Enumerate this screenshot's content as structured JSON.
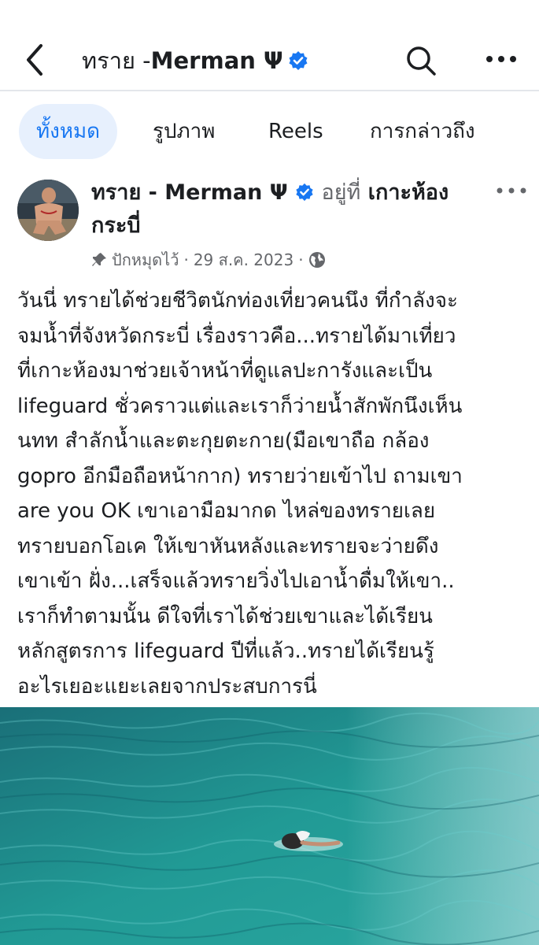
{
  "header": {
    "title_prefix": "ทราย - ",
    "title_name": "Merman Ψ",
    "icons": [
      "back-arrow-icon",
      "verified-badge-icon",
      "search-icon",
      "more-dots-icon"
    ]
  },
  "tabs": [
    {
      "label": "ทั้งหมด",
      "active": true
    },
    {
      "label": "รูปภาพ",
      "active": false
    },
    {
      "label": "Reels",
      "active": false
    },
    {
      "label": "การกล่าวถึง",
      "active": false
    }
  ],
  "post": {
    "author": "ทราย - Merman Ψ",
    "at_label": "อยู่ที่",
    "location": "เกาะห้อง กระบี่",
    "pinned_label": "ปักหมุดไว้",
    "separator": "·",
    "date": "29 ส.ค. 2023",
    "text": "วันนี่ ทรายได้ช่วยชีวิตนักท่องเที่ยวคนนึง ที่กำลังจะจมน้ำที่จังหวัดกระบี่  เรื่องราวคือ...ทรายได้มาเที่ยวที่เกาะห้องมาช่วยเจ้าหน้าที่ดูแลปะการังและเป็น lifeguard ชั่วคราวแต่และเราก็ว่ายน้ำสักพักนึงเห็นนทท สำลักน้ำและตะกุยตะกาย(มือเขาถือ กล้อง gopro อีกมือถือหน้ากาก) ทรายว่ายเข้าไป ถามเขา are you OK   เขาเอามือมากด ไหล่ของทรายเลย ทรายบอกโอเค ให้เขาหันหลังและทรายจะว่ายดึงเขาเข้า ฝั่ง...เสร็จแล้วทรายวิ่งไปเอาน้ำดื่มให้เขา.. เราก็ทำตามนั้น ดีใจที่เราได้ช่วยเขาและได้เรียนหลักสูตรการ lifeguard ปีที่แล้ว..ทรายได้เรียนรู้อะไรเยอะแยะเลยจากประสบการนี่",
    "text_lines": [
      "วันนี่ ทรายได้ช่วยชีวิตนักท่องเที่ยวคนนึง ที่กำลังจะ",
      "จมน้ำที่จังหวัดกระบี่  เรื่องราวคือ...ทรายได้มาเที่ยว",
      "ที่เกาะห้องมาช่วยเจ้าหน้าที่ดูแลปะการังและเป็น",
      "lifeguard ชั่วคราวแต่และเราก็ว่ายน้ำสักพักนึงเห็น",
      "นทท สำลักน้ำและตะกุยตะกาย(มือเขาถือ กล้อง",
      "gopro อีกมือถือหน้ากาก) ทรายว่ายเข้าไป ถามเขา",
      "are you OK   เขาเอามือมากด ไหล่ของทรายเลย",
      "ทรายบอกโอเค ให้เขาหันหลังและทรายจะว่ายดึง",
      "เขาเข้า ฝั่ง...เสร็จแล้วทรายวิ่งไปเอาน้ำดื่มให้เขา..",
      "เราก็ทำตามนั้น ดีใจที่เราได้ช่วยเขาและได้เรียน",
      "หลักสูตรการ lifeguard ปีที่แล้ว..ทรายได้เรียนรู้",
      "อะไรเยอะแยะเลยจากประสบการนี่"
    ]
  },
  "colors": {
    "accent": "#1877f2",
    "active_tab_bg": "#e7f0fd",
    "meta_gray": "#65676b",
    "water": "#1e8a8a"
  }
}
